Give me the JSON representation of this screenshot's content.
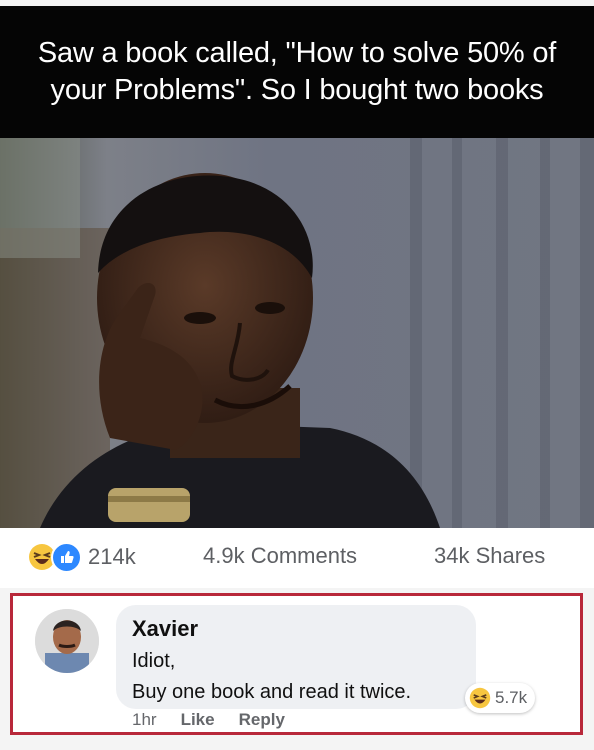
{
  "meme": {
    "caption": "Saw a book called, \"How to solve 50% of your Problems\". So I bought two books"
  },
  "stats": {
    "reactions_count": "214k",
    "comments": "4.9k Comments",
    "shares": "34k Shares",
    "reaction_icons": [
      "haha-emoji",
      "like-icon"
    ],
    "like_color": "#2d88ff"
  },
  "comment": {
    "author": "Xavier",
    "text_line1": "Idiot,",
    "text_line2": "Buy one book and read it twice.",
    "reaction_count": "5.7k",
    "time": "1hr",
    "like_label": "Like",
    "reply_label": "Reply",
    "highlight_color": "#b8283a"
  }
}
